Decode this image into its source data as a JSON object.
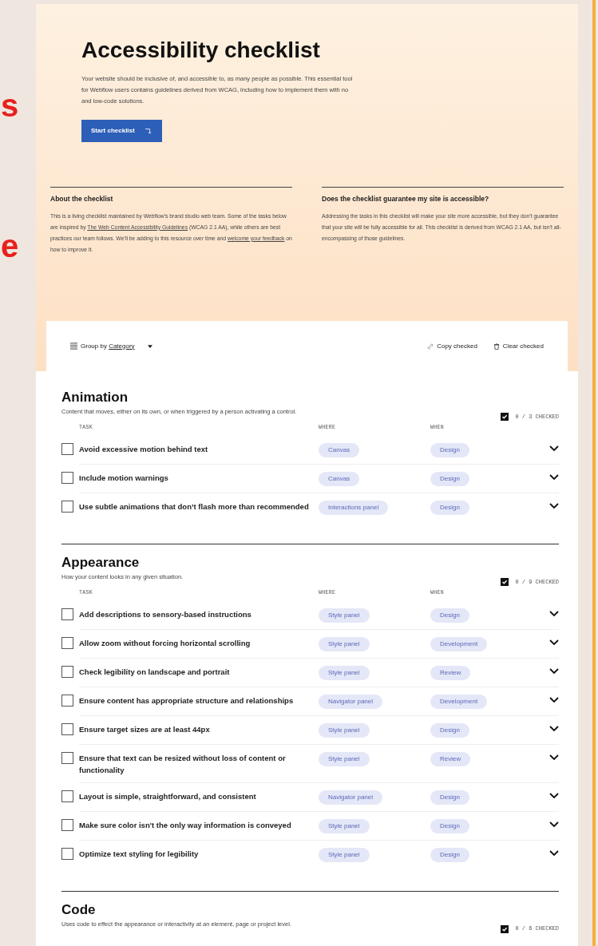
{
  "side_letters": [
    "s",
    "e"
  ],
  "hero": {
    "title": "Accessibility checklist",
    "intro": "Your website should be inclusive of, and accessible to, as many people as possible. This essential tool for Webflow users contains guidelines derived from WCAG, including how to implement them with no and low-code solutions.",
    "button": "Start checklist"
  },
  "info": [
    {
      "heading": "About the checklist",
      "parts": [
        {
          "text": "This is a living checklist maintained by Webflow’s brand studio web team. Some of the tasks below are inspired by ",
          "kind": "text"
        },
        {
          "text": "The Web Content Accessibility Guidelines",
          "kind": "link"
        },
        {
          "text": " (WCAG 2.1 AA), while others are best practices our team follows. We’ll be adding to this resource over time and ",
          "kind": "text"
        },
        {
          "text": "welcome your feedback",
          "kind": "link"
        },
        {
          "text": " on how to improve it.",
          "kind": "text"
        }
      ]
    },
    {
      "heading": "Does the checklist guarantee my site is accessible?",
      "parts": [
        {
          "text": "Addressing the tasks in this checklist will make your site more accessible, but they don’t guarantee that your site will be fully accessible for all. This checklist is derived from WCAG 2.1 AA, but isn’t all-encompassing of those guidelines.",
          "kind": "text"
        }
      ]
    }
  ],
  "toolbar": {
    "group_label": "Group by",
    "group_value": "Category",
    "copy": "Copy checked",
    "clear": "Clear checked"
  },
  "sections": [
    {
      "title": "Animation",
      "description": "Content that moves, either on its own, or when triggered by a person activating a control.",
      "count": "0 / 3 CHECKED",
      "columns": [
        "TASK",
        "WHERE",
        "WHEN"
      ],
      "tasks": [
        {
          "task": "Avoid excessive motion behind text",
          "where": "Canvas",
          "when": "Design",
          "checked": false
        },
        {
          "task": "Include motion warnings",
          "where": "Canvas",
          "when": "Design",
          "checked": false
        },
        {
          "task": "Use subtle animations that don’t flash more than recommended",
          "where": "Interactions panel",
          "when": "Design",
          "checked": false
        }
      ]
    },
    {
      "title": "Appearance",
      "description": "How your content looks in any given situation.",
      "count": "0 / 9 CHECKED",
      "columns": [
        "TASK",
        "WHERE",
        "WHEN"
      ],
      "tasks": [
        {
          "task": "Add descriptions to sensory-based instructions",
          "where": "Style panel",
          "when": "Design",
          "checked": false
        },
        {
          "task": "Allow zoom without forcing horizontal scrolling",
          "where": "Style panel",
          "when": "Development",
          "checked": false
        },
        {
          "task": "Check legibility on landscape and portrait",
          "where": "Style panel",
          "when": "Review",
          "checked": false
        },
        {
          "task": "Ensure content has appropriate structure and relationships",
          "where": "Navigator panel",
          "when": "Development",
          "checked": false
        },
        {
          "task": "Ensure target sizes are at least 44px",
          "where": "Style panel",
          "when": "Design",
          "checked": false
        },
        {
          "task": "Ensure that text can be resized without loss of content or functionality",
          "where": "Style panel",
          "when": "Review",
          "checked": false
        },
        {
          "task": "Layout is simple, straightforward, and consistent",
          "where": "Navigator panel",
          "when": "Design",
          "checked": false
        },
        {
          "task": "Make sure color isn't the only way information is conveyed",
          "where": "Style panel",
          "when": "Design",
          "checked": false
        },
        {
          "task": "Optimize text styling for legibility",
          "where": "Style panel",
          "when": "Design",
          "checked": false
        }
      ]
    },
    {
      "title": "Code",
      "description": "Uses code to effect the appearance or interactivity at an element, page or project level.",
      "count": "0 / 6 CHECKED"
    }
  ]
}
